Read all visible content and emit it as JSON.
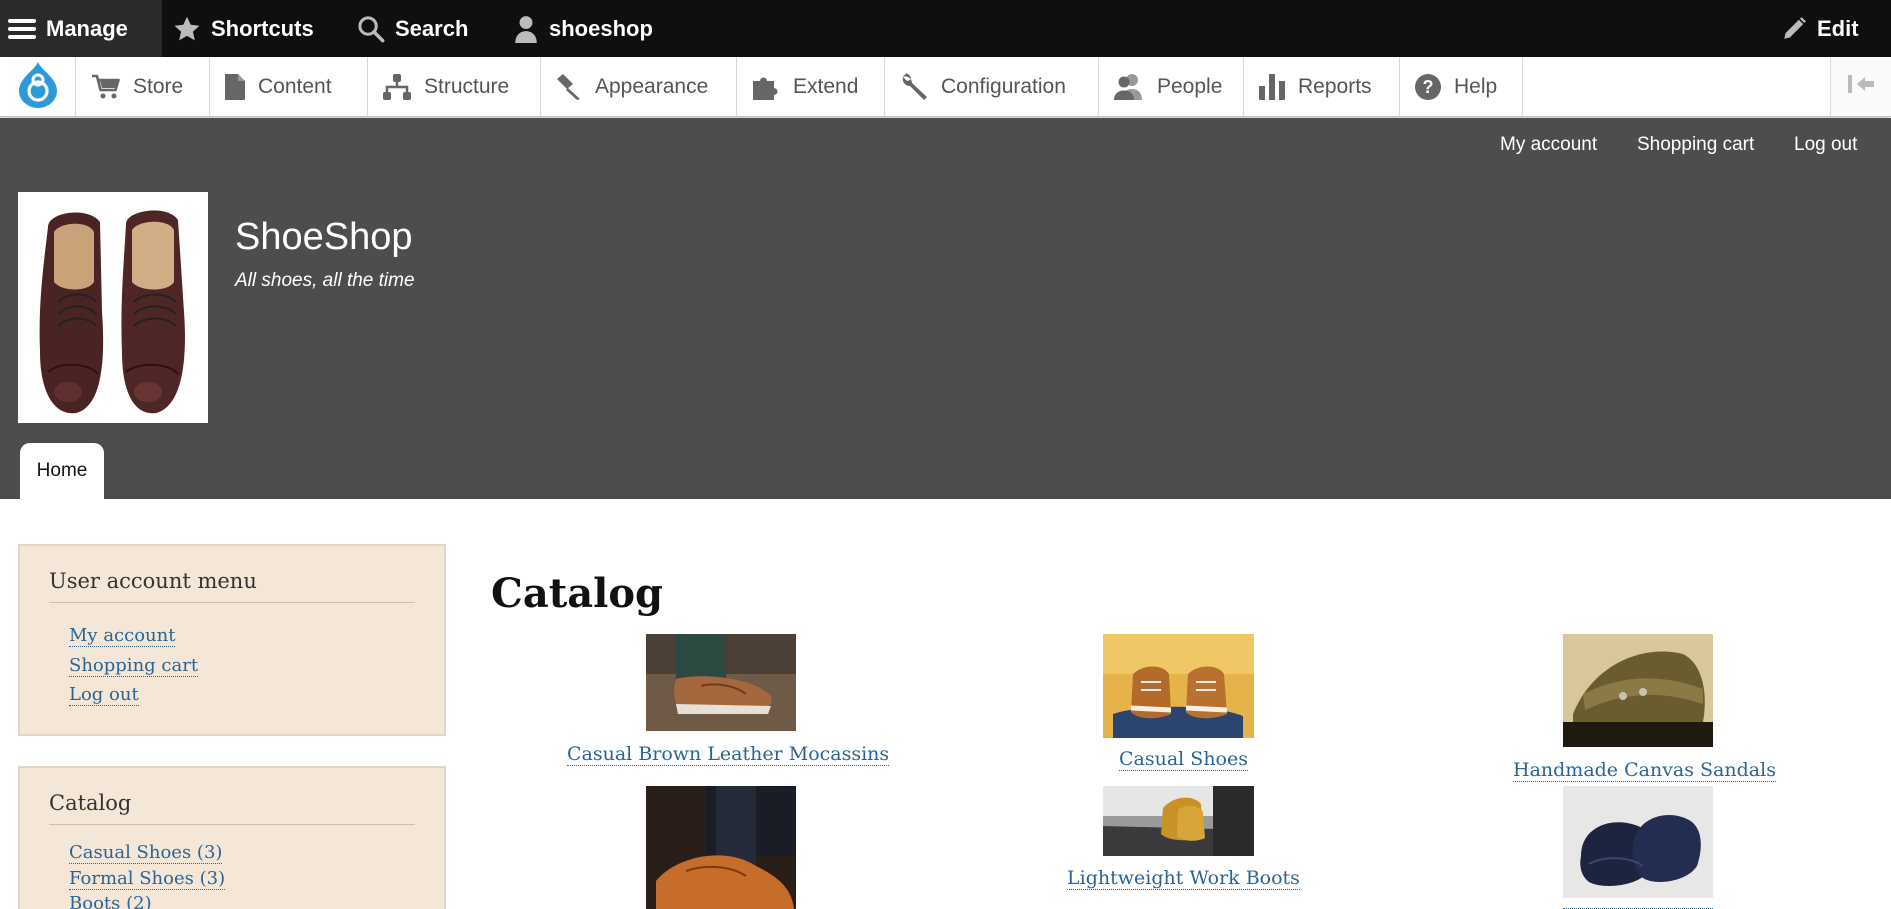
{
  "toolbar": {
    "manage": "Manage",
    "shortcuts": "Shortcuts",
    "search": "Search",
    "user": "shoeshop",
    "edit": "Edit"
  },
  "tray": {
    "items": [
      {
        "label": "Store",
        "icon": "cart-icon"
      },
      {
        "label": "Content",
        "icon": "page-icon"
      },
      {
        "label": "Structure",
        "icon": "structure-icon"
      },
      {
        "label": "Appearance",
        "icon": "brush-icon"
      },
      {
        "label": "Extend",
        "icon": "puzzle-icon"
      },
      {
        "label": "Configuration",
        "icon": "wrench-icon"
      },
      {
        "label": "People",
        "icon": "people-icon"
      },
      {
        "label": "Reports",
        "icon": "bar-chart-icon"
      },
      {
        "label": "Help",
        "icon": "help-icon"
      }
    ]
  },
  "header": {
    "secondary_menu": [
      "My account",
      "Shopping cart",
      "Log out"
    ],
    "site_name": "ShoeShop",
    "slogan": "All shoes, all the time",
    "tab_home": "Home"
  },
  "sidebar": {
    "user_menu": {
      "title": "User account menu",
      "links": [
        "My account",
        "Shopping cart",
        "Log out"
      ]
    },
    "catalog": {
      "title": "Catalog",
      "links": [
        "Casual Shoes (3)",
        "Formal Shoes (3)",
        "Boots (2)"
      ]
    }
  },
  "main": {
    "title": "Catalog",
    "products": [
      {
        "name": "Casual Brown Leather Mocassins"
      },
      {
        "name": "Casual Shoes"
      },
      {
        "name": "Handmade Canvas Sandals"
      },
      {
        "name": ""
      },
      {
        "name": "Lightweight Work Boots"
      },
      {
        "name": ""
      }
    ]
  },
  "colors": {
    "toolbar_bg": "#0f0f0f",
    "header_bg": "#4d4d4d",
    "block_bg": "#f4e7d7",
    "link": "#2a6496",
    "drupal_blue": "#2d9ad8"
  }
}
